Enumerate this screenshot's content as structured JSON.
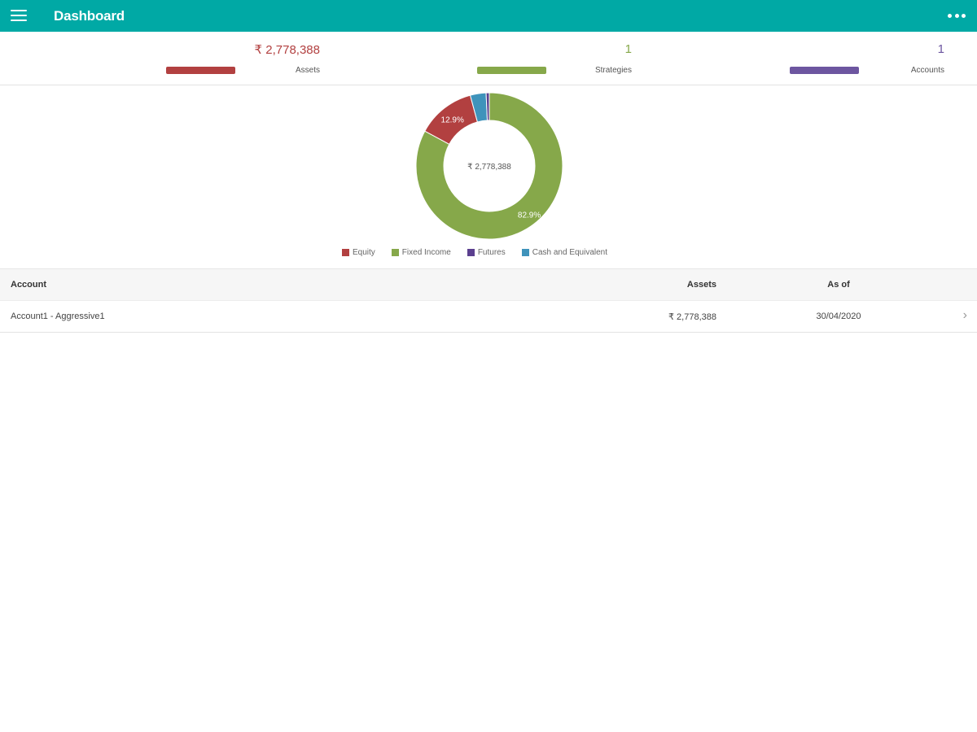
{
  "app": {
    "title": "Dashboard"
  },
  "summary": {
    "assets": {
      "value": "₹ 2,778,388",
      "label": "Assets",
      "color": "#b24040"
    },
    "strategies": {
      "value": "1",
      "label": "Strategies",
      "color": "#86a84a"
    },
    "accounts": {
      "value": "1",
      "label": "Accounts",
      "color": "#6d56a0"
    }
  },
  "chart_data": {
    "type": "pie",
    "center_label": "₹ 2,778,388",
    "slices": [
      {
        "name": "Equity",
        "value": 12.9,
        "color": "#b24040",
        "label": "12.9%"
      },
      {
        "name": "Fixed Income",
        "value": 82.9,
        "color": "#86a84a",
        "label": "82.9%"
      },
      {
        "name": "Futures",
        "value": 0.7,
        "color": "#5b3f8f",
        "label": ""
      },
      {
        "name": "Cash and Equivalent",
        "value": 3.5,
        "color": "#3f93bb",
        "label": ""
      }
    ]
  },
  "table": {
    "headers": {
      "account": "Account",
      "assets": "Assets",
      "as_of": "As of"
    },
    "rows": [
      {
        "account": "Account1 - Aggressive1",
        "assets": "₹ 2,778,388",
        "as_of": "30/04/2020"
      }
    ]
  },
  "icons": {
    "menu": "hamburger-menu-icon",
    "more": "more-horizontal-icon",
    "row_chevron": "chevron-right-icon"
  }
}
